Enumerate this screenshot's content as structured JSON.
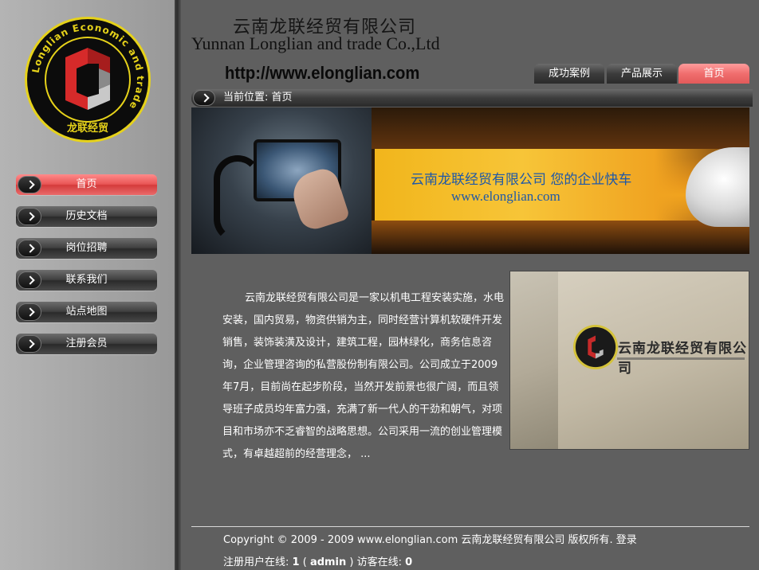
{
  "header": {
    "company_cn": "云南龙联经贸有限公司",
    "company_en": "Yunnan Longlian and trade Co.,Ltd",
    "url": "http://www.elonglian.com"
  },
  "logo": {
    "ring_text": "Longlian Economic and trade",
    "brand_cn": "龙联经贸"
  },
  "tabs": [
    {
      "label": "成功案例"
    },
    {
      "label": "产品展示"
    },
    {
      "label": "首页"
    }
  ],
  "sidebar": {
    "items": [
      {
        "label": "首页"
      },
      {
        "label": "历史文档"
      },
      {
        "label": "岗位招聘"
      },
      {
        "label": "联系我们"
      },
      {
        "label": "站点地图"
      },
      {
        "label": "注册会员"
      }
    ]
  },
  "breadcrumb": {
    "text": "当前位置: 首页"
  },
  "banner": {
    "slogan": "云南龙联经贸有限公司 您的企业快车",
    "url": "www.elonglian.com"
  },
  "intro": {
    "text": "云南龙联经贸有限公司是一家以机电工程安装实施，水电安装，国内贸易，物资供销为主，同时经营计算机软硬件开发销售，装饰装潢及设计，建筑工程，园林绿化，商务信息咨询，企业管理咨询的私营股份制有限公司。公司成立于2009年7月，目前尚在起步阶段，当然开发前景也很广阔，而且领导班子成员均年富力强，充满了新一代人的干劲和朝气，对项目和市场亦不乏睿智的战略思想。公司采用一流的创业管理模式，有卓越超前的经营理念， ..."
  },
  "photo": {
    "sign_text": "云南龙联经贸有限公司"
  },
  "footer": {
    "copyright": "Copyright © 2009 - 2009 www.elonglian.com 云南龙联经贸有限公司 版权所有.",
    "login": "登录",
    "online_prefix": "注册用户在线:",
    "online_users": "1",
    "paren_open": "(",
    "online_user_name": "admin",
    "paren_close": ")",
    "visitors_label": "访客在线:",
    "visitors": "0"
  },
  "colors": {
    "accent_red": "#e25a5a",
    "background": "#5f5f5f",
    "slogan_blue": "#1e58a8"
  }
}
